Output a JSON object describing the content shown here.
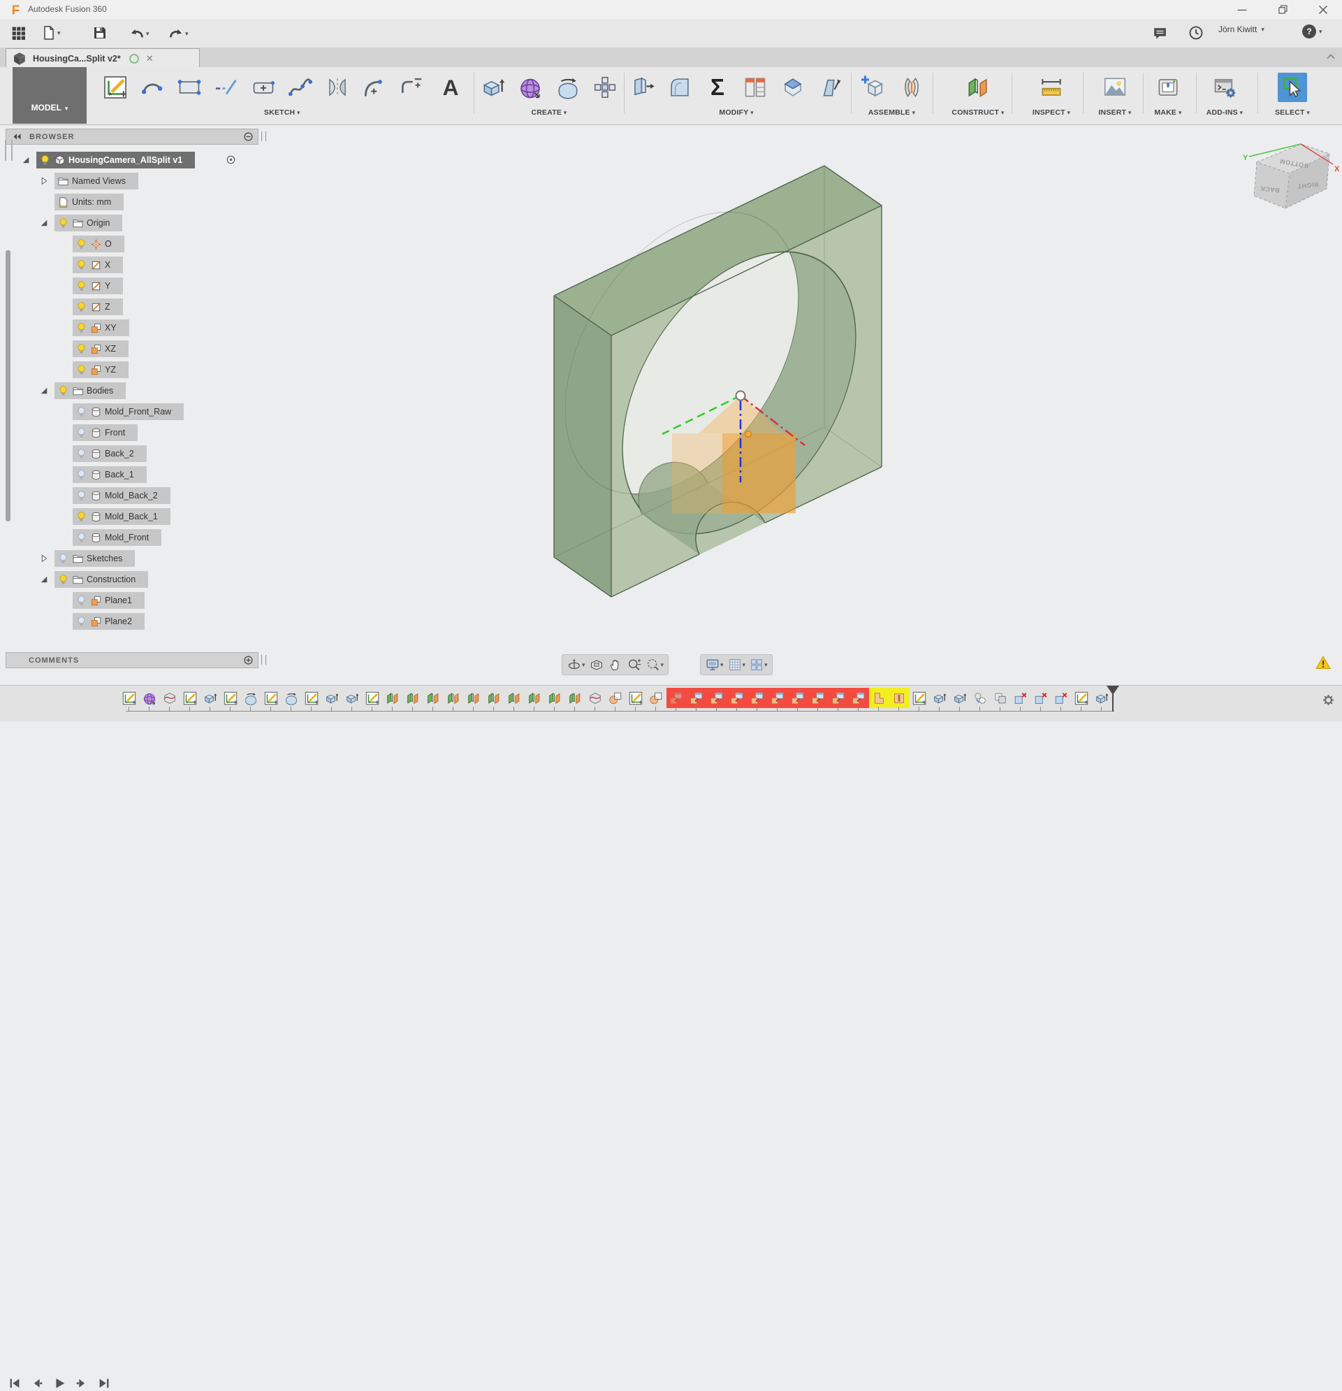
{
  "window": {
    "title": "Autodesk Fusion 360"
  },
  "glyphs": {
    "caret": "▾",
    "close": "✕",
    "ellipsis_tab_close": "✕"
  },
  "quick_access": {
    "user": "Jörn Kiwitt",
    "help_glyph": "?"
  },
  "tab": {
    "title": "HousingCa...Split v2*"
  },
  "ribbon": {
    "mode_label": "MODEL",
    "groups": [
      {
        "label": "SKETCH",
        "tools": [
          "create-sketch",
          "arc",
          "rectangle",
          "line",
          "slot",
          "spline",
          "mirror",
          "fillet",
          "corner-arc",
          "text"
        ]
      },
      {
        "label": "CREATE",
        "tools": [
          "extrude",
          "form",
          "revolve",
          "pattern"
        ]
      },
      {
        "label": "MODIFY",
        "tools": [
          "press-pull",
          "fillet-solid",
          "sigma",
          "parameters",
          "chamfer",
          "draft"
        ]
      },
      {
        "label": "ASSEMBLE",
        "tools": [
          "new-component",
          "joint"
        ]
      },
      {
        "label": "CONSTRUCT",
        "tools": [
          "plane"
        ]
      },
      {
        "label": "INSPECT",
        "tools": [
          "measure"
        ]
      },
      {
        "label": "INSERT",
        "tools": [
          "image"
        ]
      },
      {
        "label": "MAKE",
        "tools": [
          "make"
        ]
      },
      {
        "label": "ADD-INS",
        "tools": [
          "add-ins"
        ]
      },
      {
        "label": "SELECT",
        "tools": [
          "select"
        ]
      }
    ]
  },
  "browser": {
    "title": "BROWSER",
    "tree": [
      {
        "label": "HousingCamera_AllSplit v1",
        "level": 0,
        "expander": "open",
        "bulb": "on",
        "icon": "component",
        "selected": true,
        "radio": true
      },
      {
        "label": "Named Views",
        "level": 1,
        "expander": "closed",
        "bulb": null,
        "icon": "folder"
      },
      {
        "label": "Units: mm",
        "level": 1,
        "expander": null,
        "bulb": null,
        "icon": "document"
      },
      {
        "label": "Origin",
        "level": 1,
        "expander": "open",
        "bulb": "on",
        "icon": "folder"
      },
      {
        "label": "O",
        "level": 2,
        "bulb": "on",
        "icon": "point"
      },
      {
        "label": "X",
        "level": 2,
        "bulb": "on",
        "icon": "axis"
      },
      {
        "label": "Y",
        "level": 2,
        "bulb": "on",
        "icon": "axis"
      },
      {
        "label": "Z",
        "level": 2,
        "bulb": "on",
        "icon": "axis"
      },
      {
        "label": "XY",
        "level": 2,
        "bulb": "on",
        "icon": "plane"
      },
      {
        "label": "XZ",
        "level": 2,
        "bulb": "on",
        "icon": "plane"
      },
      {
        "label": "YZ",
        "level": 2,
        "bulb": "on",
        "icon": "plane"
      },
      {
        "label": "Bodies",
        "level": 1,
        "expander": "open",
        "bulb": "on",
        "icon": "folder"
      },
      {
        "label": "Mold_Front_Raw",
        "level": 2,
        "bulb": "off",
        "icon": "body"
      },
      {
        "label": "Front",
        "level": 2,
        "bulb": "off",
        "icon": "body"
      },
      {
        "label": "Back_2",
        "level": 2,
        "bulb": "off",
        "icon": "body"
      },
      {
        "label": "Back_1",
        "level": 2,
        "bulb": "off",
        "icon": "body"
      },
      {
        "label": "Mold_Back_2",
        "level": 2,
        "bulb": "off",
        "icon": "body"
      },
      {
        "label": "Mold_Back_1",
        "level": 2,
        "bulb": "on",
        "icon": "body"
      },
      {
        "label": "Mold_Front",
        "level": 2,
        "bulb": "off",
        "icon": "body"
      },
      {
        "label": "Sketches",
        "level": 1,
        "expander": "closed",
        "bulb": "off",
        "icon": "folder"
      },
      {
        "label": "Construction",
        "level": 1,
        "expander": "open",
        "bulb": "on",
        "icon": "folder"
      },
      {
        "label": "Plane1",
        "level": 2,
        "bulb": "off",
        "icon": "plane"
      },
      {
        "label": "Plane2",
        "level": 2,
        "bulb": "off",
        "icon": "plane"
      }
    ]
  },
  "comments": {
    "title": "COMMENTS"
  },
  "viewcube": {
    "top": "BOTTOM",
    "left": "BACK",
    "right": "RIGHT",
    "axis_x": "X",
    "axis_y": "Y"
  },
  "viewport_navbar": {
    "group1": [
      {
        "icon": "orbit",
        "caret": true
      },
      {
        "icon": "look-at",
        "caret": false
      },
      {
        "icon": "pan",
        "caret": false
      },
      {
        "icon": "zoom",
        "caret": false
      },
      {
        "icon": "fit",
        "caret": true
      }
    ],
    "group2": [
      {
        "icon": "display-settings",
        "caret": true
      },
      {
        "icon": "grid",
        "caret": true
      },
      {
        "icon": "viewports",
        "caret": true
      }
    ]
  },
  "timeline": {
    "playback": [
      "skip-start",
      "step-back",
      "play",
      "step-forward",
      "skip-end"
    ],
    "items": [
      {
        "type": "sketch"
      },
      {
        "type": "form"
      },
      {
        "type": "surface"
      },
      {
        "type": "sketch"
      },
      {
        "type": "extrude"
      },
      {
        "type": "sketch"
      },
      {
        "type": "revolve"
      },
      {
        "type": "sketch"
      },
      {
        "type": "revolve"
      },
      {
        "type": "sketch"
      },
      {
        "type": "extrude"
      },
      {
        "type": "extrude"
      },
      {
        "type": "sketch"
      },
      {
        "type": "plane"
      },
      {
        "type": "plane"
      },
      {
        "type": "plane"
      },
      {
        "type": "plane"
      },
      {
        "type": "plane"
      },
      {
        "type": "plane"
      },
      {
        "type": "plane"
      },
      {
        "type": "plane"
      },
      {
        "type": "plane"
      },
      {
        "type": "plane"
      },
      {
        "type": "surface"
      },
      {
        "type": "split"
      },
      {
        "type": "sketch"
      },
      {
        "type": "split"
      },
      {
        "type": "combine",
        "highlight": "red",
        "faded": true
      },
      {
        "type": "combine",
        "highlight": "red"
      },
      {
        "type": "combine",
        "highlight": "red"
      },
      {
        "type": "combine",
        "highlight": "red"
      },
      {
        "type": "combine",
        "highlight": "red"
      },
      {
        "type": "combine",
        "highlight": "red"
      },
      {
        "type": "combine",
        "highlight": "red"
      },
      {
        "type": "combine",
        "highlight": "red"
      },
      {
        "type": "combine",
        "highlight": "red"
      },
      {
        "type": "combine",
        "highlight": "red"
      },
      {
        "type": "corner",
        "highlight": "yellow"
      },
      {
        "type": "rib",
        "highlight": "yellow"
      },
      {
        "type": "sketch"
      },
      {
        "type": "extrude"
      },
      {
        "type": "extrude"
      },
      {
        "type": "link"
      },
      {
        "type": "boolean"
      },
      {
        "type": "delete"
      },
      {
        "type": "delete"
      },
      {
        "type": "delete"
      },
      {
        "type": "sketch"
      },
      {
        "type": "extrude"
      }
    ]
  }
}
